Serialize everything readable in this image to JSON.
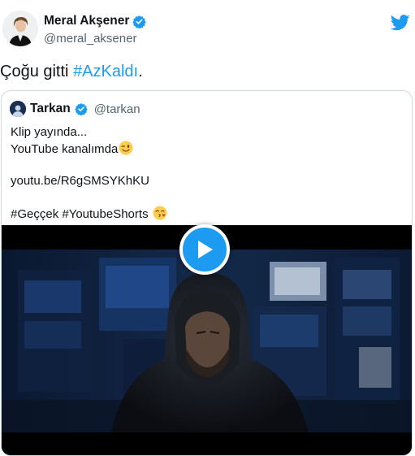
{
  "author": {
    "name": "Meral Akşener",
    "handle": "@meral_aksener",
    "verified": true,
    "avatar_icon": "person-avatar-icon"
  },
  "tweet": {
    "text_prefix": "Çoğu gitti ",
    "hashtag": "#AzKaldı",
    "text_suffix": "."
  },
  "quoted_tweet": {
    "name": "Tarkan",
    "handle": "@tarkan",
    "verified": true,
    "lines": [
      "Klip yayında...",
      "YouTube kanalımda",
      "",
      "youtu.be/R6gSMSYKhKU",
      "",
      "#Geççek #YoutubeShorts"
    ],
    "emojis": [
      "winking-face-emoji",
      "face-blowing-kiss-emoji"
    ],
    "media": {
      "type": "video",
      "play_icon": "play-icon"
    }
  },
  "colors": {
    "accent": "#1d9bf0",
    "text": "#0f1419",
    "secondary_text": "#536471",
    "border": "#cfd9de"
  },
  "logo": "twitter-bird-icon"
}
